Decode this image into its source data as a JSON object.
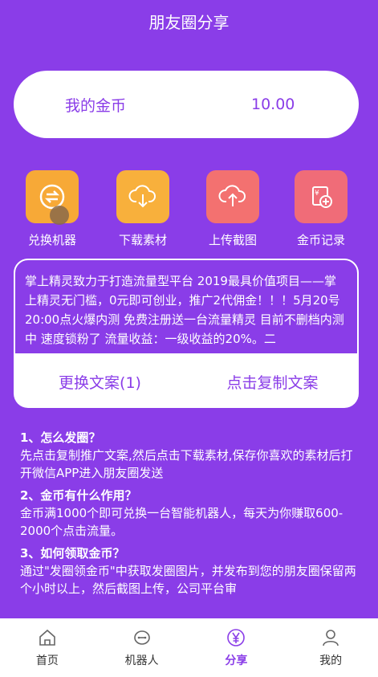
{
  "header": {
    "title": "朋友圈分享"
  },
  "coin": {
    "label": "我的金币",
    "value": "10.00"
  },
  "actions": [
    {
      "label": "兑换机器",
      "icon": "exchange-icon"
    },
    {
      "label": "下载素材",
      "icon": "cloud-download-icon"
    },
    {
      "label": "上传截图",
      "icon": "cloud-upload-icon"
    },
    {
      "label": "金币记录",
      "icon": "coin-record-icon"
    }
  ],
  "copy": {
    "text": "掌上精灵致力于打造流量型平台 2019最具价值项目——掌上精灵无门槛，0元即可创业，推广2代佣金！！！5月20号20:00点火爆内测 免费注册送一台流量精灵 目前不删档内测中 速度锁粉了 流量收益：一级收益的20%。二",
    "change_button": "更换文案(1)",
    "copy_button": "点击复制文案"
  },
  "faq": [
    {
      "q": "1、怎么发圈？",
      "a": "先点击复制推广文案,然后点击下载素材,保存你喜欢的素材后打开微信APP进入朋友圈发送"
    },
    {
      "q": "2、金币有什么作用？",
      "a": "金币满1000个即可兑换一台智能机器人，每天为你赚取600-2000个点击流量。"
    },
    {
      "q": "3、如何领取金币？",
      "a": "通过\"发圈领金币\"中获取发圈图片，并发布到您的朋友圈保留两个小时以上，然后截图上传，公司平台审"
    }
  ],
  "tabs": [
    {
      "label": "首页",
      "icon": "home-icon"
    },
    {
      "label": "机器人",
      "icon": "robot-icon"
    },
    {
      "label": "分享",
      "icon": "yen-icon"
    },
    {
      "label": "我的",
      "icon": "user-icon"
    }
  ],
  "colors": {
    "primary": "#8a3de8",
    "active_tab": "#8a3de8"
  }
}
